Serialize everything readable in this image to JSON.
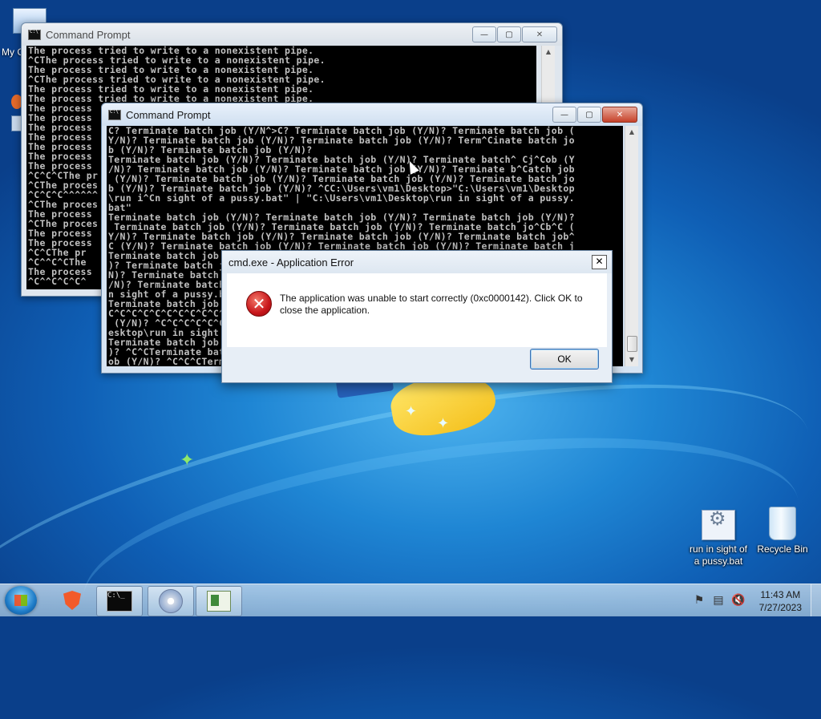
{
  "desktop": {
    "corner_icon_label": "My C",
    "icons": [
      {
        "label": "run in sight of a pussy.bat",
        "icon": "batch-file-icon"
      },
      {
        "label": "Recycle Bin",
        "icon": "recycle-bin-icon"
      }
    ]
  },
  "back_window": {
    "title": "Command Prompt",
    "lines": [
      "The process tried to write to a nonexistent pipe.",
      "^CThe process tried to write to a nonexistent pipe.",
      "The process tried to write to a nonexistent pipe.",
      "^CThe process tried to write to a nonexistent pipe.",
      "The process tried to write to a nonexistent pipe.",
      "The process tried to write to a nonexistent pipe.",
      "The process",
      "The process",
      "The process",
      "The process",
      "The process",
      "The process",
      "The process",
      "^C^C^CThe pr",
      "^CThe proces",
      "^C^C^C^^^^^^",
      "^CThe proces",
      "The process",
      "^CThe proces",
      "The process",
      "The process",
      "^C^CThe pr",
      "^C^^C^CThe",
      "The process",
      "^C^^C^C^C^"
    ]
  },
  "front_window": {
    "title": "Command Prompt",
    "lines": [
      "C? Terminate batch job (Y/N^>C? Terminate batch job (Y/N)? Terminate batch job (",
      "Y/N)? Terminate batch job (Y/N)? Terminate batch job (Y/N)? Term^Cinate batch jo",
      "b (Y/N)? Terminate batch job (Y/N)?",
      "Terminate batch job (Y/N)? Terminate batch job (Y/N)? Terminate batch^ Cj^Cob (Y",
      "/N)? Terminate batch job (Y/N)? Terminate batch job (Y/N)? Terminate b^Catch job",
      " (Y/N)? Terminate batch job (Y/N)? Terminate batch job (Y/N)? Terminate batch jo",
      "b (Y/N)? Terminate batch job (Y/N)? ^CC:\\Users\\vm1\\Desktop>\"C:\\Users\\vm1\\Desktop",
      "\\run i^Cn sight of a pussy.bat\" | \"C:\\Users\\vm1\\Desktop\\run in sight of a pussy.",
      "bat\"",
      "Terminate batch job (Y/N)? Terminate batch job (Y/N)? Terminate batch job (Y/N)?",
      " Terminate batch job (Y/N)? Terminate batch job (Y/N)? Terminate batch jo^Cb^C (",
      "Y/N)? Terminate batch job (Y/N)? Terminate batch job (Y/N)? Terminate batch job^",
      "C (Y/N)? Terminate batch job (Y/N)? Terminate batch job (Y/N)? Terminate batch j",
      "Terminate batch job (Y/N)? Terminate batch job (Y/N)? Terminate batch job (Y/N",
      ")? Terminate batch job (Y/N)? Terminate batch job (Y/N)? Terminate batch job (Y/",
      "N)? Terminate batch job (Y/N)? Terminate batch job (Y/N)? Terminate batch job (Y",
      "/N)? Terminate batch job (Y/N)? Terminate batch job (Y/N)? Terminate batch job (",
      "n sight of a pussy.bat\" | \"C:\\Users\\vm1\\Desktop\\run in sight of a pussy.bat\"",
      "Terminate batch job (Y/N)? Terminate batch job (Y/N)? Terminate batch job (Y/N)^",
      "C^C^C^C^C^C^C^C^C^C^C^C^C^C^C^C^C^C^C^C^C^C^C^C^C^C^C^C^C^C^C^C^C^C^C^C^C^C^b",
      " (Y/N)? ^C^C^C^C^C^C^C^C^C^C^C^C^C^C^C^C^C^C^C^C^C^C^C^C^C^C^C^C^C^C^C^C^C^C^D",
      "esktop\\run in sight of a pussy.bat\" | \"C:\\Users\\vm1\\Desktop\\run in sight of a p",
      "Terminate batch job (Y/N)? Terminate batch job (Y/N)? Terminate batch job (Y/N)?",
      ")? ^C^CTerminate batch job (Y/N)? Terminate batch job (Y/N)? Terminate batch j",
      "ob (Y/N)? ^C^C^CTerminate batch job (Y/N)? Terminate batch job (Y/N)? Terminate"
    ]
  },
  "dialog": {
    "title": "cmd.exe - Application Error",
    "message": "The application was unable to start correctly (0xc0000142). Click OK to close the application.",
    "ok_label": "OK",
    "close_glyph": "✕",
    "icon": "error-icon"
  },
  "window_buttons": {
    "minimize": "—",
    "maximize": "▢",
    "close": "✕"
  },
  "taskbar": {
    "items": [
      "start-orb",
      "brave-browser",
      "command-prompt",
      "installer",
      "document-viewer"
    ],
    "time": "11:43 AM",
    "date": "7/27/2023"
  }
}
